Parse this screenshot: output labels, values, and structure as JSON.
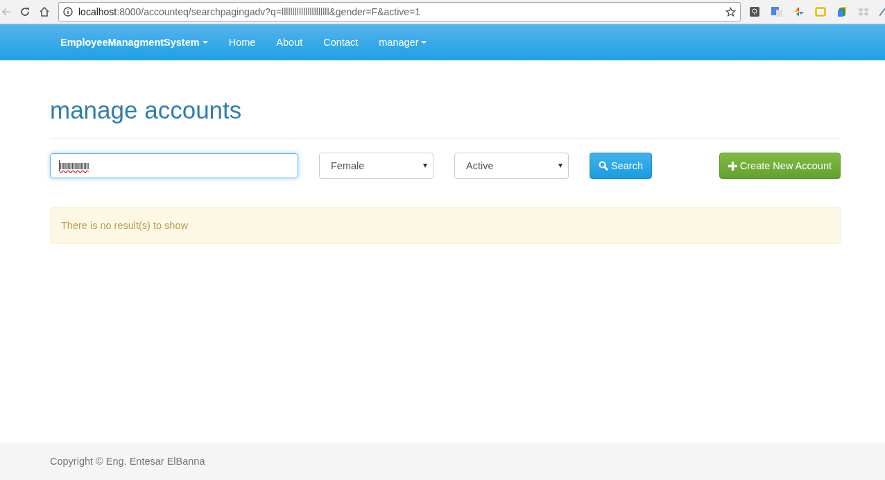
{
  "browser": {
    "url_host": "localhost",
    "url_rest": ":8000/accounteq/searchpagingadv?q=llllllllllllllllllllll&gender=F&active=1"
  },
  "navbar": {
    "brand": "EmployeeManagmentSystem",
    "items": [
      {
        "label": "Home",
        "kind": "link"
      },
      {
        "label": "About",
        "kind": "link"
      },
      {
        "label": "Contact",
        "kind": "link"
      },
      {
        "label": "manager",
        "kind": "dropdown"
      }
    ]
  },
  "page": {
    "title": "manage accounts"
  },
  "filters": {
    "query": "llllllllllllllllllllll",
    "gender": "Female",
    "status": "Active",
    "search_button": "Search",
    "create_button": "Create New Account"
  },
  "alert": {
    "message": "There is no result(s) to show"
  },
  "footer": {
    "copyright": "Copyright © Eng. Entesar ElBanna"
  }
}
